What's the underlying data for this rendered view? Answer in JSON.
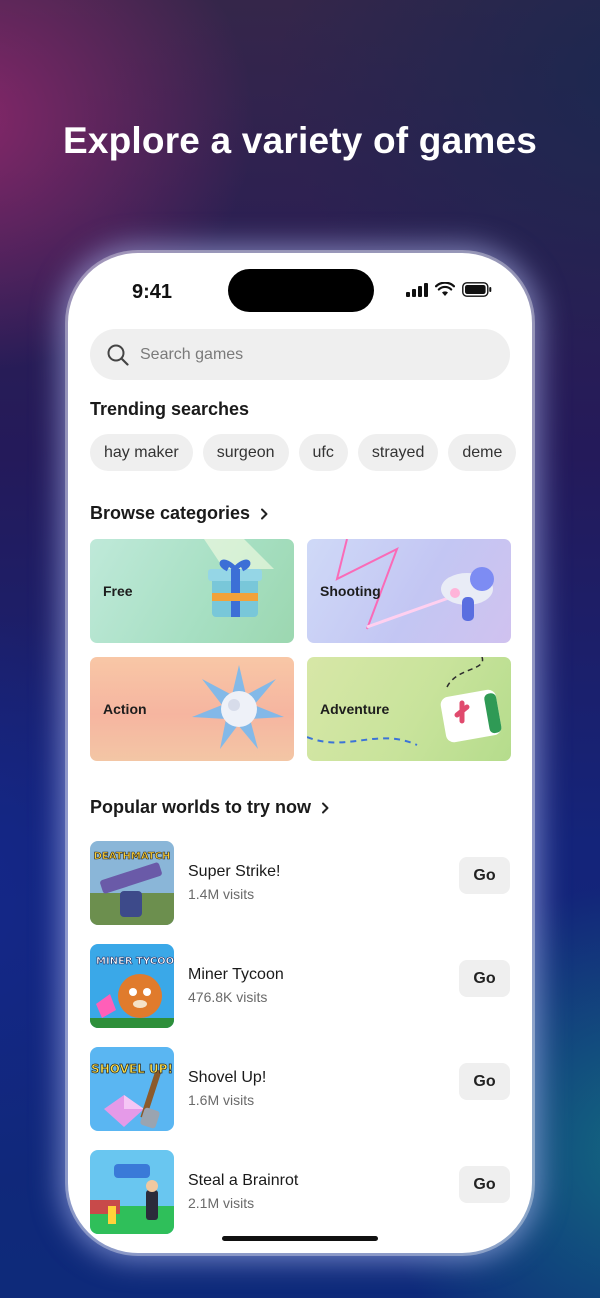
{
  "headline": "Explore a variety of games",
  "status_bar": {
    "time": "9:41"
  },
  "search": {
    "placeholder": "Search games"
  },
  "trending": {
    "title": "Trending searches",
    "chips": [
      "hay maker",
      "surgeon",
      "ufc",
      "strayed",
      "deme"
    ]
  },
  "categories": {
    "title": "Browse categories",
    "items": [
      {
        "label": "Free",
        "color": "#b8e6cf"
      },
      {
        "label": "Shooting",
        "color": "#c9c4f2"
      },
      {
        "label": "Action",
        "color": "#f6c4a4"
      },
      {
        "label": "Adventure",
        "color": "#cfe59a"
      }
    ]
  },
  "popular": {
    "title": "Popular worlds to try now",
    "items": [
      {
        "name": "Super Strike!",
        "visits": "1.4M visits",
        "button": "Go",
        "thumb_text": "DEATHMATCH"
      },
      {
        "name": "Miner Tycoon",
        "visits": "476.8K visits",
        "button": "Go",
        "thumb_text": "MINER TYCOON"
      },
      {
        "name": "Shovel Up!",
        "visits": "1.6M visits",
        "button": "Go",
        "thumb_text": "SHOVEL UP!"
      },
      {
        "name": "Steal a Brainrot",
        "visits": "2.1M visits",
        "button": "Go",
        "thumb_text": ""
      }
    ]
  }
}
